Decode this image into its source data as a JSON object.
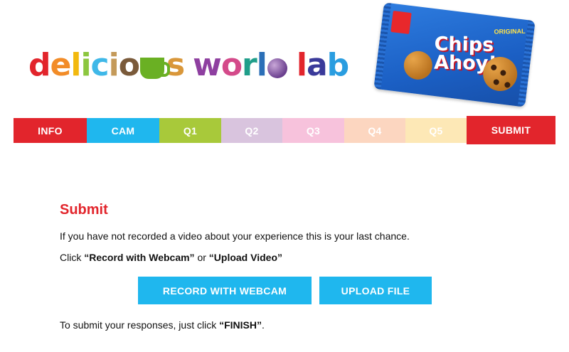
{
  "brand": {
    "logo_text": "delicious world lab",
    "logo_letters": [
      {
        "t": "d",
        "c": "#e2252c"
      },
      {
        "t": "e",
        "c": "#f28c28"
      },
      {
        "t": "l",
        "c": "#f2b90f"
      },
      {
        "t": "i",
        "c": "#8cc63f"
      },
      {
        "t": "c",
        "c": "#3fb8e8"
      },
      {
        "t": "i",
        "c": "#c49a5a"
      },
      {
        "t": "o",
        "c": "#7a5a3a"
      },
      {
        "t": "u",
        "c": "#6b3f1f"
      },
      {
        "t": "s",
        "c": "#d9973a"
      },
      {
        "t": "w",
        "c": "#8e3fa0"
      },
      {
        "t": "o",
        "c": "#d44a8a"
      },
      {
        "t": "r",
        "c": "#1f9e8a"
      },
      {
        "t": "l",
        "c": "#2b6fb7"
      },
      {
        "t": "d",
        "c": "#e05a2a"
      },
      {
        "t": "l",
        "c": "#e2252c"
      },
      {
        "t": "a",
        "c": "#3a3a9a"
      },
      {
        "t": "b",
        "c": "#2a9de0"
      }
    ]
  },
  "product": {
    "name": "Chips Ahoy!",
    "variant": "ORIGINAL",
    "colors": {
      "bag": "#1b5fc4",
      "accent": "#c0182a"
    }
  },
  "tabs": [
    {
      "label": "INFO",
      "color": "#e2252c",
      "text_color": "#ffffff",
      "width": 103
    },
    {
      "label": "CAM",
      "color": "#1fb7ee",
      "text_color": "#ffffff",
      "width": 102
    },
    {
      "label": "Q1",
      "color": "#a8c93a",
      "text_color": "#ffffff",
      "width": 87
    },
    {
      "label": "Q2",
      "color": "#d9c4de",
      "text_color": "#ffffff",
      "width": 86
    },
    {
      "label": "Q3",
      "color": "#f7c2dc",
      "text_color": "#ffffff",
      "width": 87
    },
    {
      "label": "Q4",
      "color": "#fcd6c0",
      "text_color": "#ffffff",
      "width": 86
    },
    {
      "label": "Q5",
      "color": "#fde8b6",
      "text_color": "#ffffff",
      "width": 86
    },
    {
      "label": "SUBMIT",
      "color": "#e2252c",
      "text_color": "#ffffff",
      "width": 125
    }
  ],
  "main": {
    "title": "Submit",
    "line1": "If you have not recorded a video about your experience this is your last chance.",
    "line2_prefix": "Click ",
    "line2_record": "“Record with Webcam”",
    "line2_or": " or ",
    "line2_upload": "“Upload Video”",
    "record_button": "RECORD WITH WEBCAM",
    "upload_button": "UPLOAD FILE",
    "finish_prefix": "To submit your responses, just click ",
    "finish_word": "“FINISH”",
    "finish_suffix": "."
  }
}
